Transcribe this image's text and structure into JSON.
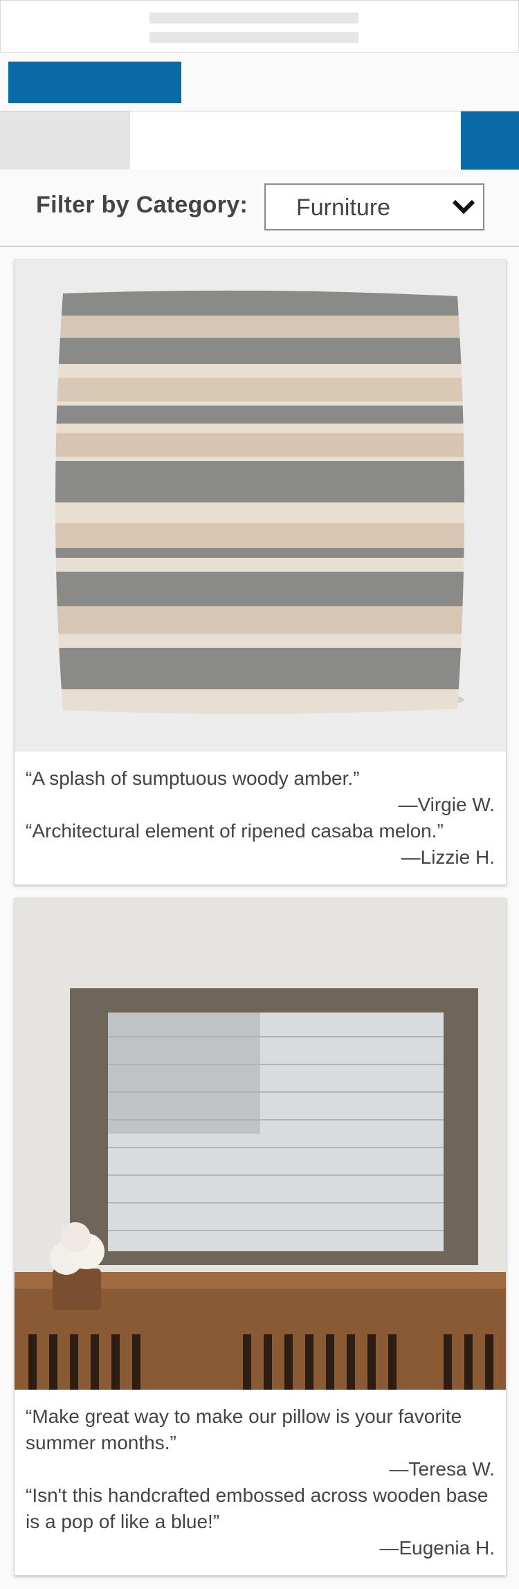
{
  "filter": {
    "label": "Filter by Category:",
    "selected": "Furniture"
  },
  "products": [
    {
      "image": "striped-pillow",
      "reviews": [
        {
          "quote": "“A splash of sumptuous woody amber.”",
          "author": "—Virgie  W."
        },
        {
          "quote": "“Architectural element of ripened casaba melon.”",
          "author": "—Lizzie H."
        }
      ]
    },
    {
      "image": "corrugated-flag-wall-art",
      "reviews": [
        {
          "quote": "“Make great way to make our pillow is your favorite summer months.”",
          "author": "—Teresa W."
        },
        {
          "quote": "“Isn't this handcrafted embossed across wooden base is a pop of like a blue!”",
          "author": "—Eugenia H."
        }
      ]
    }
  ],
  "colors": {
    "accent": "#0a6aa8",
    "placeholder": "#e4e4e4"
  }
}
